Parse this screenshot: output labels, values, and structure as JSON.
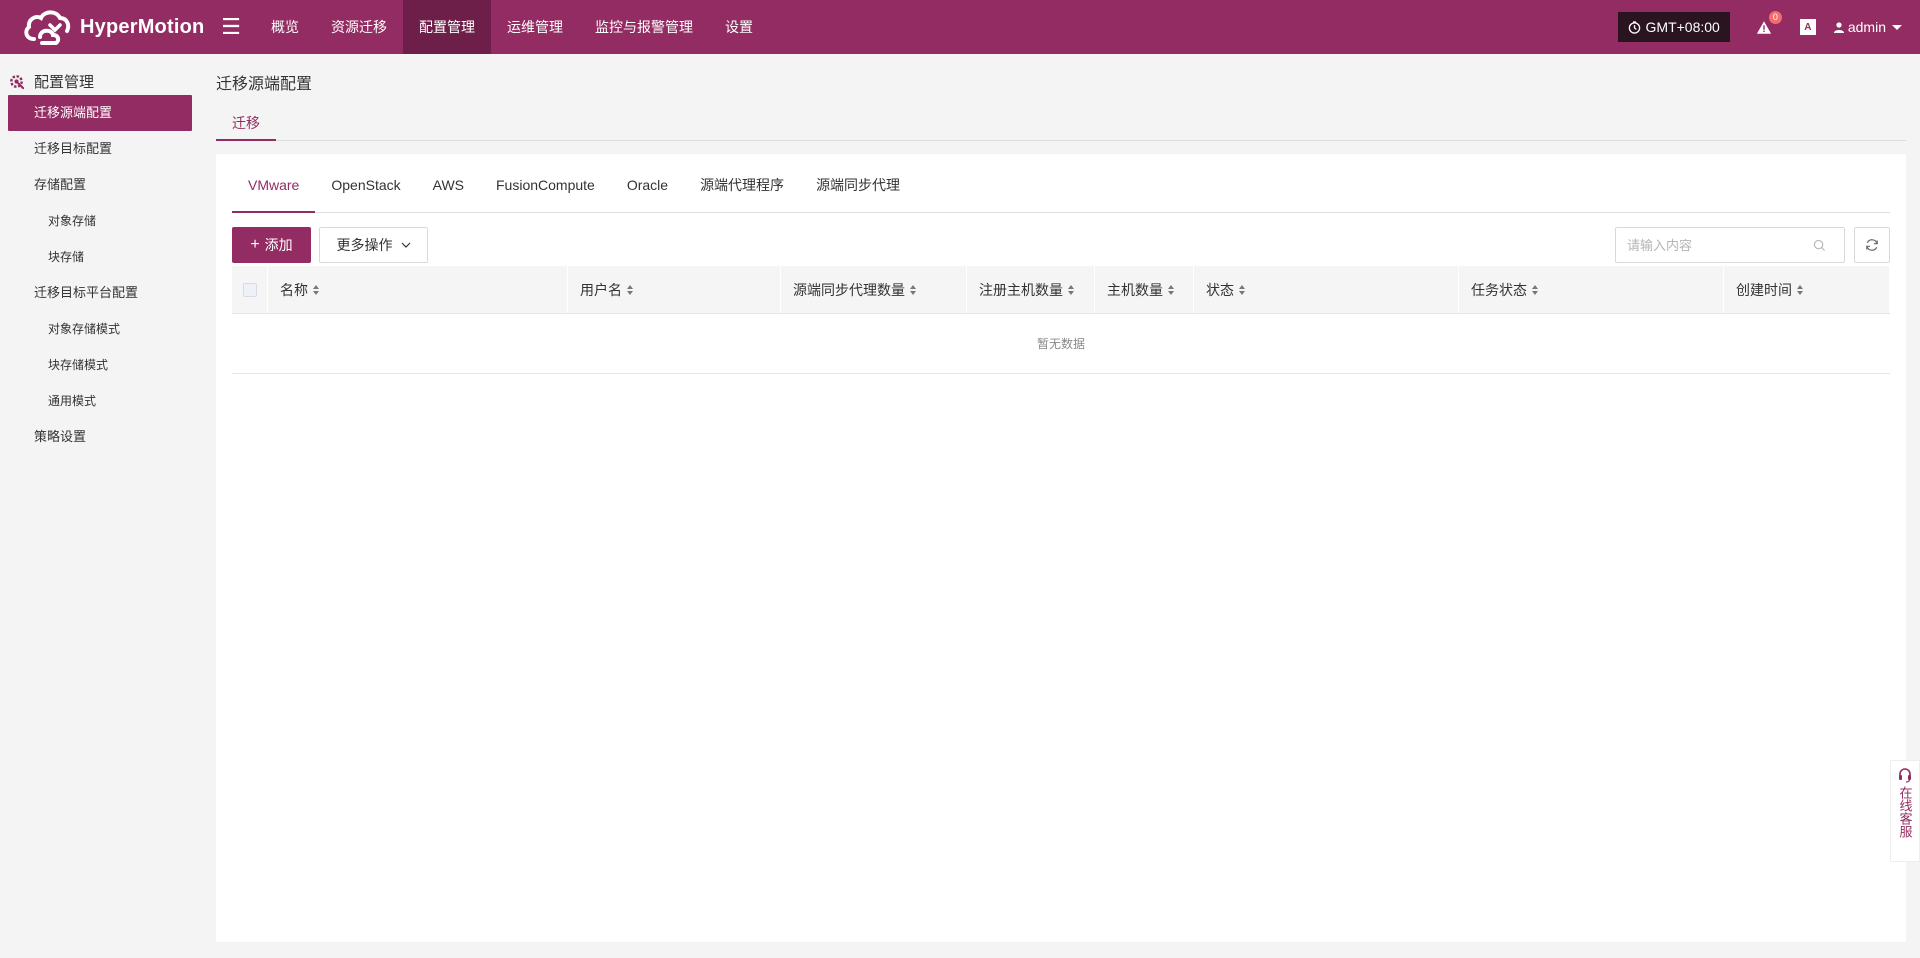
{
  "topbar": {
    "brand": "HyperMotion",
    "nav": [
      {
        "label": "概览",
        "active": false
      },
      {
        "label": "资源迁移",
        "active": false
      },
      {
        "label": "配置管理",
        "active": true
      },
      {
        "label": "运维管理",
        "active": false
      },
      {
        "label": "监控与报警管理",
        "active": false
      },
      {
        "label": "设置",
        "active": false
      }
    ],
    "timezone": "GMT+08:00",
    "alert_count": "0",
    "lang_icon": "A",
    "user": "admin",
    "accent": "#932c62"
  },
  "sidebar": {
    "title": "配置管理",
    "items": [
      {
        "label": "迁移源端配置",
        "level": 1,
        "active": true
      },
      {
        "label": "迁移目标配置",
        "level": 1,
        "active": false
      },
      {
        "label": "存储配置",
        "level": 1,
        "active": false
      },
      {
        "label": "对象存储",
        "level": 2,
        "active": false
      },
      {
        "label": "块存储",
        "level": 2,
        "active": false
      },
      {
        "label": "迁移目标平台配置",
        "level": 1,
        "active": false
      },
      {
        "label": "对象存储模式",
        "level": 2,
        "active": false
      },
      {
        "label": "块存储模式",
        "level": 2,
        "active": false
      },
      {
        "label": "通用模式",
        "level": 2,
        "active": false
      },
      {
        "label": "策略设置",
        "level": 1,
        "active": false
      }
    ]
  },
  "main": {
    "title": "迁移源端配置",
    "top_tab": "迁移",
    "subtabs": [
      {
        "label": "VMware",
        "active": true
      },
      {
        "label": "OpenStack",
        "active": false
      },
      {
        "label": "AWS",
        "active": false
      },
      {
        "label": "FusionCompute",
        "active": false
      },
      {
        "label": "Oracle",
        "active": false
      },
      {
        "label": "源端代理程序",
        "active": false
      },
      {
        "label": "源端同步代理",
        "active": false
      }
    ],
    "add_label": "添加",
    "more_label": "更多操作",
    "search_placeholder": "请输入内容",
    "columns": [
      "名称",
      "用户名",
      "源端同步代理数量",
      "注册主机数量",
      "主机数量",
      "状态",
      "任务状态",
      "创建时间"
    ],
    "empty_text": "暂无数据"
  },
  "service": {
    "label": "在线客服"
  }
}
